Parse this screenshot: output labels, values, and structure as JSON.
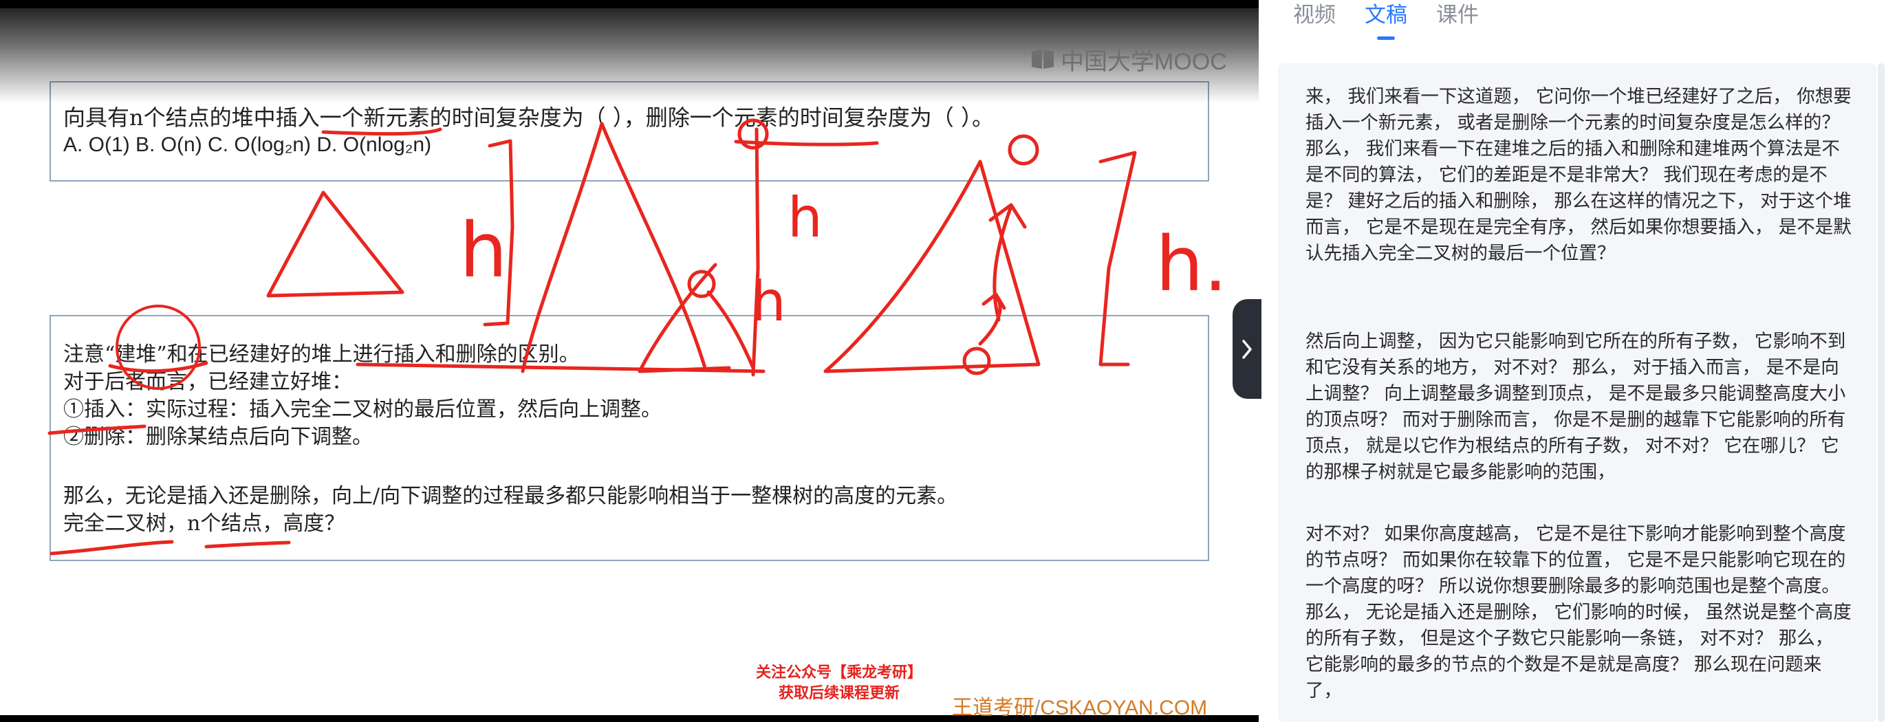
{
  "video": {
    "brand": "中国大学MOOC",
    "question_line": "向具有n个结点的堆中插入一个新元素的时间复杂度为（        ），删除一个元素的时间复杂度为（        ）。",
    "options_line": "A. O(1)   B. O(n)   C. O(log₂n)          D. O(nlog₂n)",
    "note_lines": [
      "注意“建堆”和在已经建好的堆上进行插入和删除的区别。",
      "对于后者而言，已经建立好堆：",
      "①插入：实际过程：插入完全二叉树的最后位置，然后向上调整。",
      "②删除：删除某结点后向下调整。",
      "那么，无论是插入还是删除，向上/向下调整的过程最多都只能影响相当于一整棵树的高度的元素。",
      "完全二叉树，n个结点，高度？"
    ],
    "promo_line1": "关注公众号【乘龙考研】",
    "promo_line2": "获取后续课程更新",
    "watermark_cn": "王道考研",
    "watermark_sep": "/",
    "watermark_en": "CSKAOYAN.COM",
    "ink_labels": [
      "h",
      "h",
      "h",
      "h."
    ]
  },
  "panel": {
    "tabs": [
      {
        "label": "视频",
        "active": false
      },
      {
        "label": "文稿",
        "active": true
      },
      {
        "label": "课件",
        "active": false
      }
    ],
    "paragraphs": [
      "来， 我们来看一下这道题， 它问你一个堆已经建好了之后， 你想要插入一个新元素， 或者是删除一个元素的时间复杂度是怎么样的？ 那么， 我们来看一下在建堆之后的插入和删除和建堆两个算法是不是不同的算法， 它们的差距是不是非常大？ 我们现在考虑的是不是？ 建好之后的插入和删除， 那么在这样的情况之下， 对于这个堆而言， 它是不是现在是完全有序， 然后如果你想要插入， 是不是默认先插入完全二叉树的最后一个位置？",
      "然后向上调整， 因为它只能影响到它所在的所有子数， 它影响不到和它没有关系的地方， 对不对？ 那么， 对于插入而言， 是不是向上调整？ 向上调整最多调整到顶点， 是不是最多只能调整高度大小的顶点呀？ 而对于删除而言， 你是不是删的越靠下它能影响的所有顶点， 就是以它作为根结点的所有子数， 对不对？ 它在哪儿？ 它的那棵子树就是它最多能影响的范围，",
      "对不对？ 如果你高度越高， 它是不是往下影响才能影响到整个高度的节点呀？ 而如果你在较靠下的位置， 它是不是只能影响它现在的一个高度的呀？ 所以说你想要删除最多的影响范围也是整个高度。 那么， 无论是插入还是删除， 它们影响的时候， 虽然说是整个高度的所有子数， 但是这个子数它只能影响一条链， 对不对？ 那么， 它能影响的最多的节点的个数是不是就是高度？ 那么现在问题来了，"
    ]
  },
  "colors": {
    "ink": "#e8261f",
    "accent": "#2b78ff",
    "box_border": "#8fa4be",
    "promo": "#e6231e",
    "watermark": "#d47a24"
  }
}
